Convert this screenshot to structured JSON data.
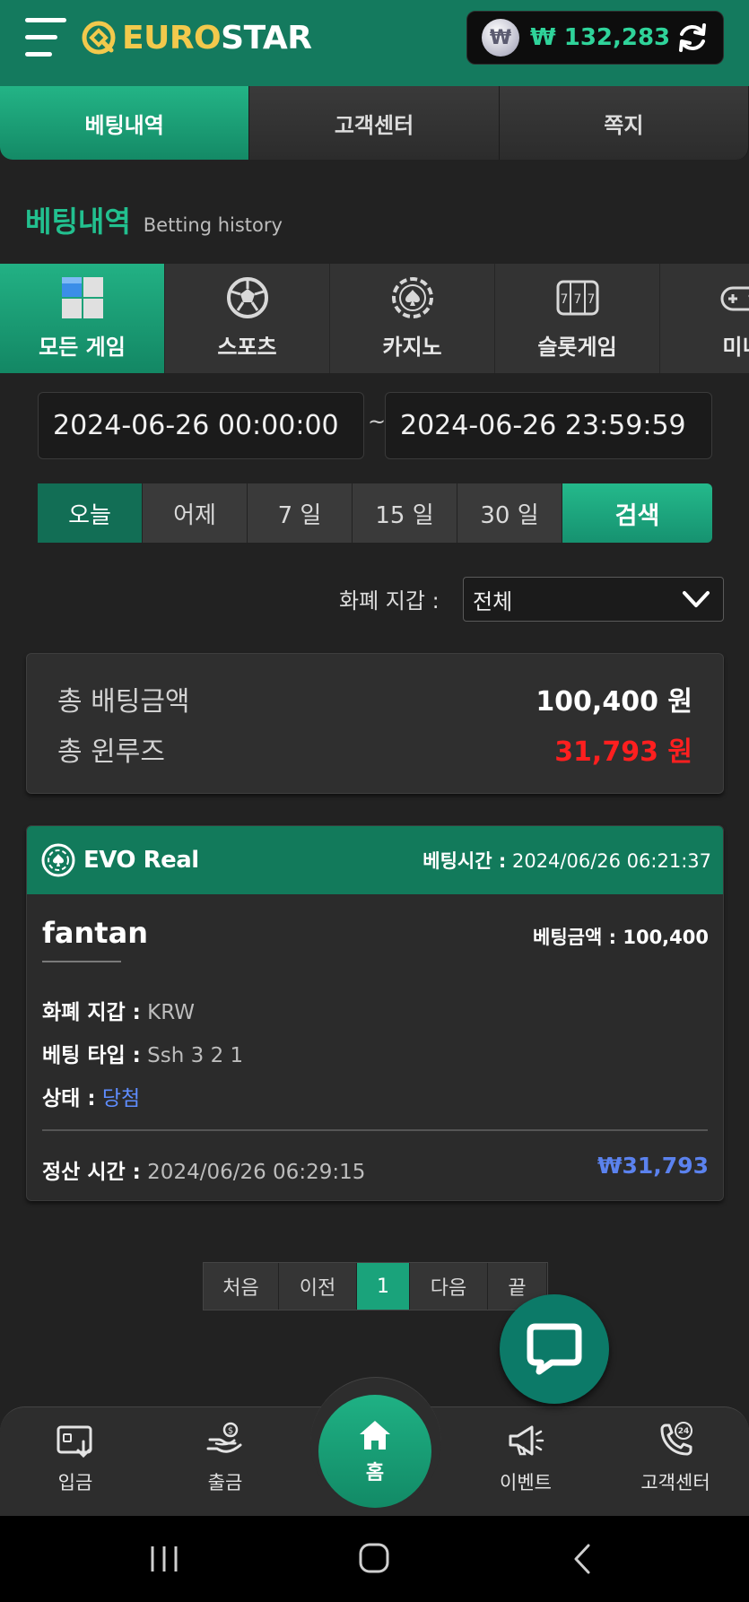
{
  "header": {
    "logo_a": "EURO",
    "logo_b": "STAR",
    "currency_symbol": "₩",
    "balance": "₩ 132,283"
  },
  "top_tabs": [
    {
      "label": "베팅내역",
      "active": true
    },
    {
      "label": "고객센터",
      "active": false
    },
    {
      "label": "쪽지",
      "active": false
    }
  ],
  "section": {
    "title_ko": "베팅내역",
    "title_en": "Betting history"
  },
  "game_tabs": [
    {
      "label": "모든 게임",
      "icon": "cubes-icon",
      "active": true
    },
    {
      "label": "스포츠",
      "icon": "soccer-ball-icon"
    },
    {
      "label": "카지노",
      "icon": "casino-chip-icon"
    },
    {
      "label": "슬롯게임",
      "icon": "slot-machine-icon"
    },
    {
      "label": "미니",
      "icon": "gamepad-icon"
    }
  ],
  "date_range": {
    "from": "2024-06-26 00:00:00",
    "separator": "~",
    "to": "2024-06-26 23:59:59"
  },
  "periods": [
    {
      "label": "오늘",
      "active": true
    },
    {
      "label": "어제"
    },
    {
      "label": "7 일"
    },
    {
      "label": "15 일"
    },
    {
      "label": "30 일"
    }
  ],
  "search_label": "검색",
  "currency_filter": {
    "label": "화폐 지갑 :",
    "selected": "전체"
  },
  "summary": {
    "total_bet_label": "총 배팅금액",
    "total_bet_value": "100,400 원",
    "total_win_label": "총 윈루즈",
    "total_win_value": "31,793 원"
  },
  "bet_card": {
    "provider": "EVO Real",
    "bet_time_label": "베팅시간 :",
    "bet_time": "2024/06/26 06:21:37",
    "game": "fantan",
    "bet_amount_label": "베팅금액 :",
    "bet_amount": "100,400",
    "currency_label": "화폐 지갑 :",
    "currency": "KRW",
    "bet_type_label": "베팅 타입 :",
    "bet_type": "Ssh 3 2 1",
    "status_label": "상태 :",
    "status": "당첨",
    "settle_label": "정산 시간 :",
    "settle_time": "2024/06/26 06:29:15",
    "payout": "₩31,793"
  },
  "pager": [
    {
      "label": "처음"
    },
    {
      "label": "이전"
    },
    {
      "label": "1",
      "active": true
    },
    {
      "label": "다음"
    },
    {
      "label": "끝"
    }
  ],
  "bottom_nav": {
    "deposit": "입금",
    "withdraw": "출금",
    "home": "홈",
    "event": "이벤트",
    "support": "고객센터",
    "support_badge": "24"
  },
  "colors": {
    "accent": "#1aa37b",
    "header": "#147a5e",
    "loss": "#ff1f1f",
    "win": "#5b82ee"
  }
}
